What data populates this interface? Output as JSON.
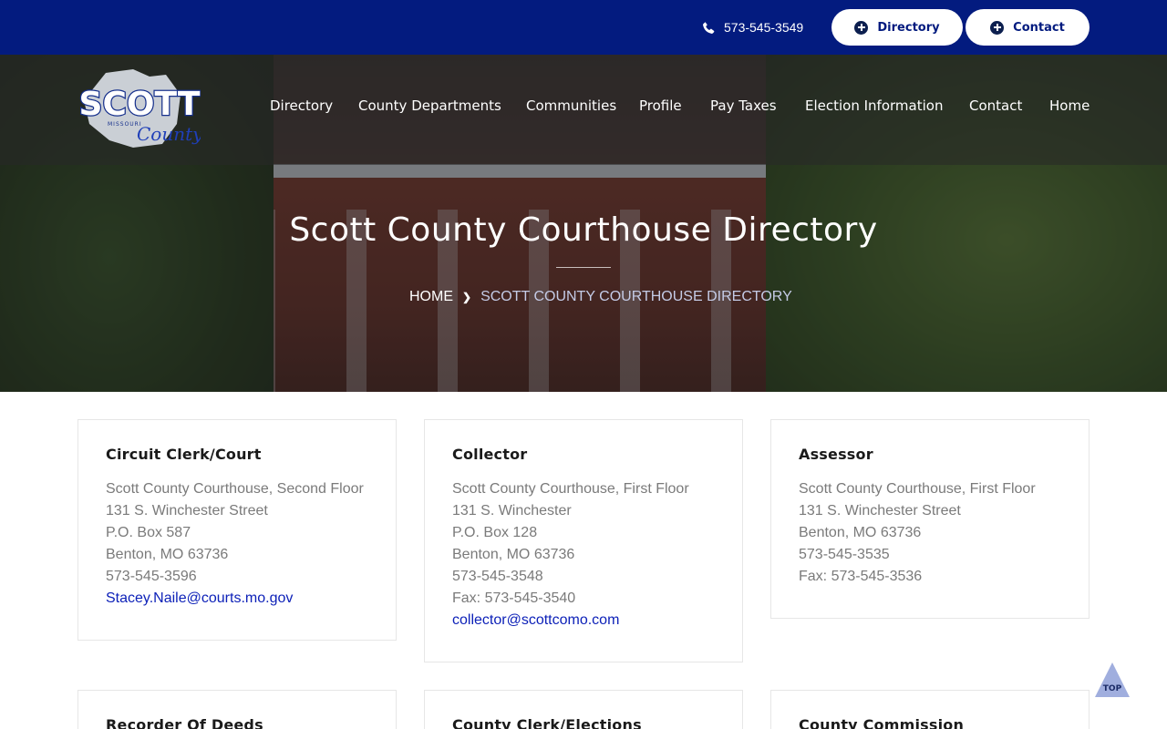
{
  "topbar": {
    "phone": "573-545-3549",
    "directory_label": "Directory",
    "contact_label": "Contact"
  },
  "logo": {
    "wordmark": "SCOTT",
    "state": "MISSOURI",
    "script": "County"
  },
  "nav": [
    "Directory",
    "County Departments",
    "Communities",
    "Profile",
    "Pay Taxes",
    "Election Information",
    "Contact",
    "Home"
  ],
  "hero": {
    "title": "Scott County Courthouse Directory",
    "breadcrumb_home": "HOME",
    "breadcrumb_current": "SCOTT COUNTY COURTHOUSE DIRECTORY"
  },
  "cards": [
    {
      "title": "Circuit Clerk/Court",
      "lines": [
        "Scott County Courthouse, Second Floor",
        "131 S. Winchester Street",
        "P.O. Box 587",
        "Benton, MO 63736",
        "573-545-3596"
      ],
      "email": "Stacey.Naile@courts.mo.gov"
    },
    {
      "title": "Collector",
      "lines": [
        "Scott County Courthouse, First Floor",
        "131 S. Winchester",
        "P.O. Box 128",
        "Benton, MO 63736",
        "573-545-3548",
        "Fax: 573-545-3540"
      ],
      "email": "collector@scottcomo.com"
    },
    {
      "title": "Assessor",
      "lines": [
        "Scott County Courthouse, First Floor",
        "131 S. Winchester Street",
        "Benton, MO 63736",
        "573-545-3535",
        "Fax: 573-545-3536"
      ],
      "email": ""
    },
    {
      "title": "Recorder Of Deeds"
    },
    {
      "title": "County Clerk/Elections"
    },
    {
      "title": "County Commission"
    }
  ],
  "top_button": "TOP",
  "colors": {
    "brand_navy": "#031b7f",
    "link_blue": "#0d21b8",
    "body_text_gray": "#7a7a7a"
  }
}
